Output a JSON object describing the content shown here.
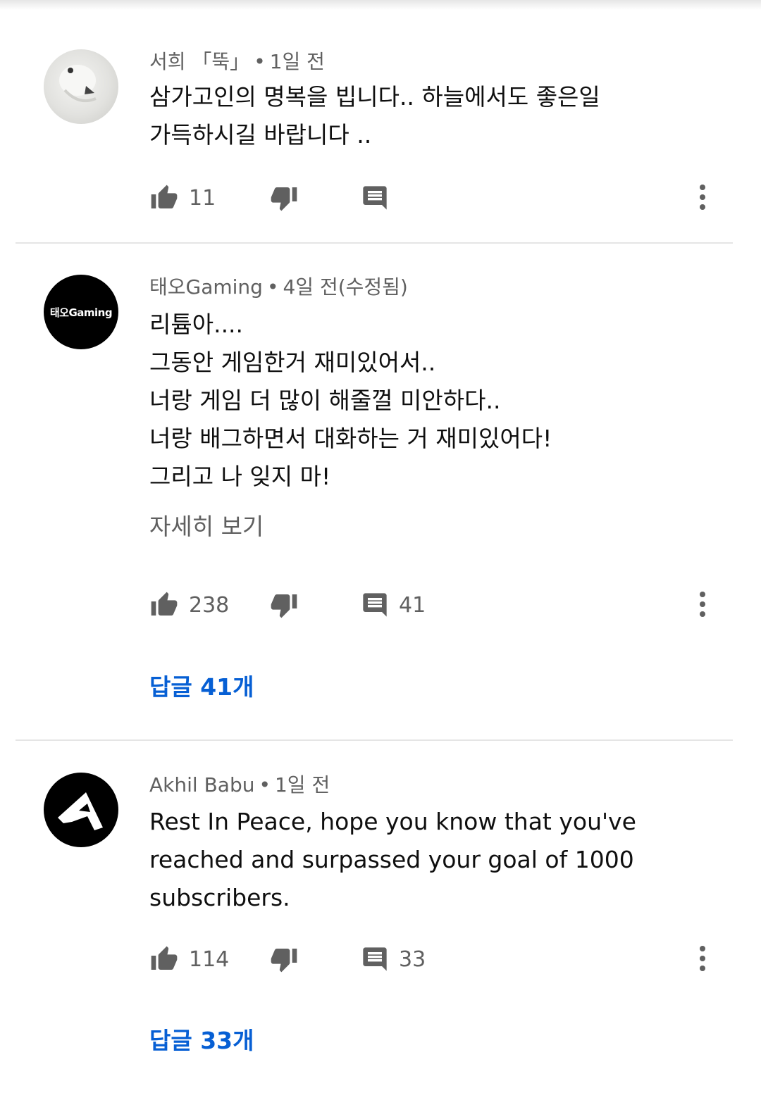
{
  "comments": [
    {
      "author": "서희 「뚝」",
      "time": "1일 전",
      "lines": [
        "삼가고인의 명복을 빕니다.. 하늘에서도  좋은일",
        "가득하시길 바랍니다 .."
      ],
      "likes": "11",
      "reply_count": ""
    },
    {
      "author": "태오Gaming",
      "time": "4일 전(수정됨)",
      "avatar_text": "태오Gaming",
      "lines": [
        "리튬아....",
        "그동안 게임한거 재미있어서..",
        "너랑 게임 더 많이 해줄껄 미안하다..",
        "너랑 배그하면서 대화하는 거 재미있어다!",
        "그리고 나 잊지 마!"
      ],
      "read_more": "자세히 보기",
      "likes": "238",
      "reply_count": "41",
      "replies_label": "답글 41개"
    },
    {
      "author": "Akhil Babu",
      "time": "1일 전",
      "lines": [
        "Rest In Peace, hope you know that you've",
        "reached and surpassed your goal of 1000",
        "subscribers."
      ],
      "likes": "114",
      "reply_count": "33",
      "replies_label": "답글 33개"
    }
  ],
  "icons": {
    "like": "thumb-up-icon",
    "dislike": "thumb-down-icon",
    "reply": "comment-icon",
    "menu": "more-vert-icon"
  },
  "colors": {
    "link": "#065fd4",
    "secondary_text": "#606060",
    "icon": "#606060"
  }
}
